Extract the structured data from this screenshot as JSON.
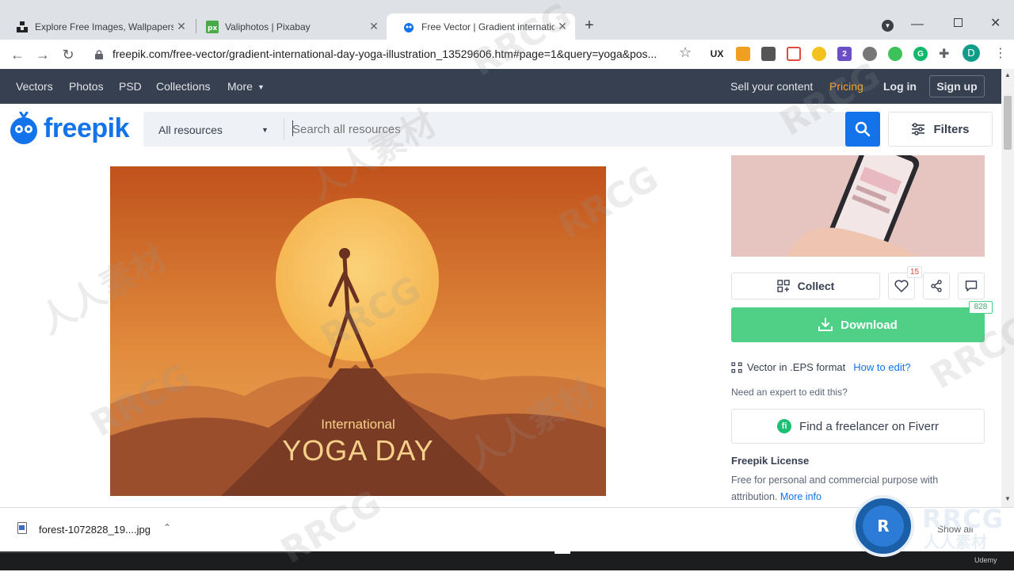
{
  "browser": {
    "tabs": [
      {
        "title": "Explore Free Images, Wallpapers"
      },
      {
        "title": "Valiphotos | Pixabay"
      },
      {
        "title": "Free Vector | Gradient internatio"
      }
    ],
    "new_tab_symbol": "+",
    "url": "freepik.com/free-vector/gradient-international-day-yoga-illustration_13529606.htm#page=1&query=yoga&pos...",
    "profile_initial": "D"
  },
  "topnav": {
    "left": [
      "Vectors",
      "Photos",
      "PSD",
      "Collections",
      "More"
    ],
    "sell": "Sell your content",
    "pricing": "Pricing",
    "login": "Log in",
    "signup": "Sign up"
  },
  "header": {
    "logo": "freepik",
    "resource_select": "All resources",
    "search_placeholder": "Search all resources",
    "filters": "Filters"
  },
  "artwork": {
    "line1": "International",
    "line2": "YOGA DAY"
  },
  "sidebar": {
    "collect": "Collect",
    "like_count": "15",
    "download": "Download",
    "download_count": "828",
    "format_text": "Vector in .EPS format",
    "how_to_edit": "How to edit?",
    "expert_text": "Need an expert to edit this?",
    "fiverr": "Find a freelancer on Fiverr",
    "license_title": "Freepik License",
    "license_text": "Free for personal and commercial purpose with attribution.",
    "more_info": "More info"
  },
  "download_bar": {
    "file": "forest-1072828_19....jpg",
    "show_all": "Show all"
  },
  "watermark": {
    "brand": "RRCG",
    "cn": "人人素材",
    "udemy": "Udemy"
  },
  "colors": {
    "nav_bg": "#374050",
    "pricing": "#f5a623",
    "accent_blue": "#1273eb",
    "download_green": "#4ed187",
    "link_blue": "#1273eb"
  }
}
